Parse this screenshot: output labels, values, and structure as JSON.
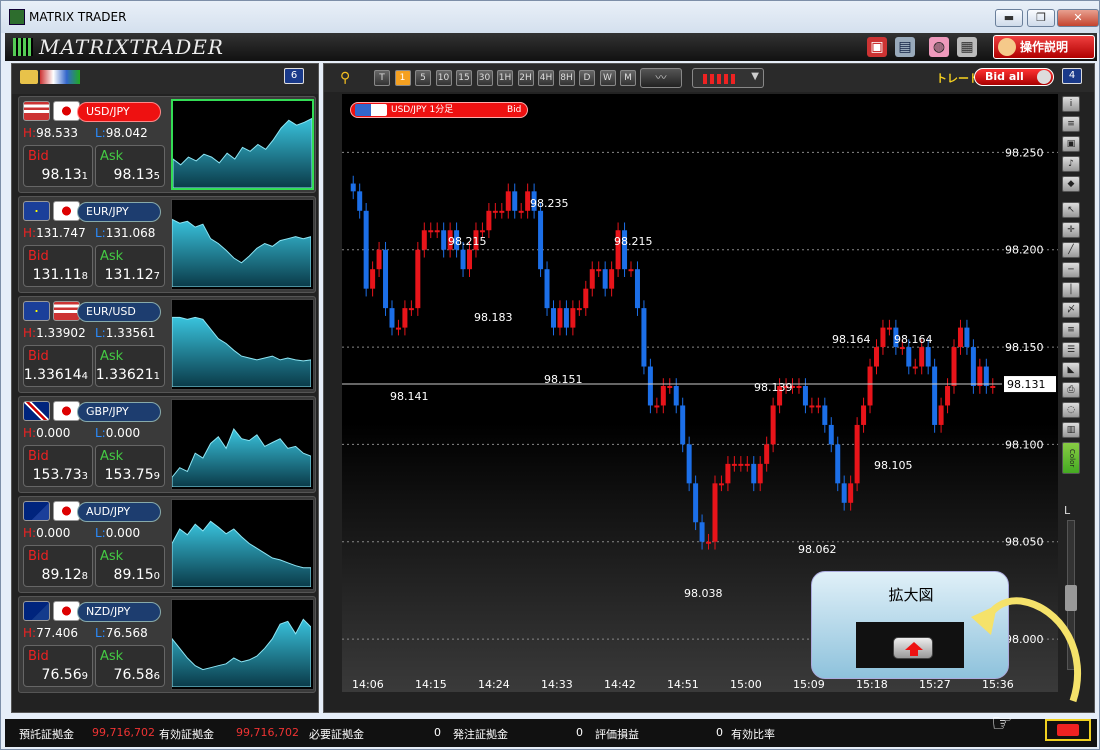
{
  "window": {
    "title": "MATRIX TRADER",
    "min_label": "▬",
    "max_label": "❐",
    "close_label": "✕"
  },
  "brand": {
    "logo_text": "MATRIXTRADER",
    "help_label": "操作説明"
  },
  "left_panel": {
    "count_badge": "6"
  },
  "pairs": [
    {
      "name": "USD/JPY",
      "flags": [
        "us",
        "jp"
      ],
      "active": true,
      "high_label": "H:",
      "high": "98.533",
      "low_label": "L:",
      "low": "98.042",
      "bid_label": "Bid",
      "bid_main": "98.13",
      "bid_pip": "1",
      "ask_label": "Ask",
      "ask_main": "98.13",
      "ask_pip": "5"
    },
    {
      "name": "EUR/JPY",
      "flags": [
        "eu",
        "jp"
      ],
      "active": false,
      "high_label": "H:",
      "high": "131.747",
      "low_label": "L:",
      "low": "131.068",
      "bid_label": "Bid",
      "bid_main": "131.11",
      "bid_pip": "8",
      "ask_label": "Ask",
      "ask_main": "131.12",
      "ask_pip": "7"
    },
    {
      "name": "EUR/USD",
      "flags": [
        "eu",
        "us"
      ],
      "active": false,
      "high_label": "H:",
      "high": "1.33902",
      "low_label": "L:",
      "low": "1.33561",
      "bid_label": "Bid",
      "bid_main": "1.33614",
      "bid_pip": "4",
      "ask_label": "Ask",
      "ask_main": "1.33621",
      "ask_pip": "1"
    },
    {
      "name": "GBP/JPY",
      "flags": [
        "gb",
        "jp"
      ],
      "active": false,
      "high_label": "H:",
      "high": "0.000",
      "low_label": "L:",
      "low": "0.000",
      "bid_label": "Bid",
      "bid_main": "153.73",
      "bid_pip": "3",
      "ask_label": "Ask",
      "ask_main": "153.75",
      "ask_pip": "9"
    },
    {
      "name": "AUD/JPY",
      "flags": [
        "au",
        "jp"
      ],
      "active": false,
      "high_label": "H:",
      "high": "0.000",
      "low_label": "L:",
      "low": "0.000",
      "bid_label": "Bid",
      "bid_main": "89.12",
      "bid_pip": "8",
      "ask_label": "Ask",
      "ask_main": "89.15",
      "ask_pip": "0"
    },
    {
      "name": "NZD/JPY",
      "flags": [
        "nz",
        "jp"
      ],
      "active": false,
      "high_label": "H:",
      "high": "77.406",
      "low_label": "L:",
      "low": "76.568",
      "bid_label": "Bid",
      "bid_main": "76.56",
      "bid_pip": "9",
      "ask_label": "Ask",
      "ask_main": "76.58",
      "ask_pip": "6"
    }
  ],
  "chart_toolbar": {
    "timeframes": [
      "T",
      "1",
      "5",
      "10",
      "15",
      "30",
      "1H",
      "2H",
      "4H",
      "8H",
      "D",
      "W",
      "M"
    ],
    "active_timeframe": "1",
    "trade_label": "トレード",
    "bid_all_label": "Bid all",
    "count_badge": "4"
  },
  "chart_tag": {
    "symbol_label": "USD/JPY 1分足",
    "side_label": "Bid"
  },
  "chart_data": {
    "type": "candlestick",
    "symbol": "USD/JPY",
    "timeframe": "1分足",
    "price_axis_ticks": [
      "98.250",
      "98.200",
      "98.150",
      "98.100",
      "98.050",
      "98.000"
    ],
    "ylim": [
      97.98,
      98.28
    ],
    "time_axis_ticks": [
      "14:06",
      "14:15",
      "14:24",
      "14:33",
      "14:42",
      "14:51",
      "15:00",
      "15:09",
      "15:18",
      "15:27",
      "15:36"
    ],
    "current_price": "98.131",
    "annotations": [
      "98.141",
      "98.215",
      "98.183",
      "98.235",
      "98.151",
      "98.215",
      "98.038",
      "98.139",
      "98.062",
      "98.164",
      "98.164",
      "98.105"
    ],
    "grid": true,
    "close_series": [
      98.23,
      98.22,
      98.18,
      98.19,
      98.2,
      98.17,
      98.16,
      98.16,
      98.17,
      98.17,
      98.2,
      98.21,
      98.21,
      98.21,
      98.2,
      98.21,
      98.2,
      98.19,
      98.2,
      98.21,
      98.21,
      98.22,
      98.22,
      98.22,
      98.23,
      98.22,
      98.22,
      98.23,
      98.22,
      98.19,
      98.17,
      98.16,
      98.17,
      98.16,
      98.17,
      98.17,
      98.18,
      98.19,
      98.19,
      98.18,
      98.19,
      98.21,
      98.19,
      98.19,
      98.17,
      98.14,
      98.12,
      98.12,
      98.13,
      98.13,
      98.12,
      98.1,
      98.08,
      98.06,
      98.05,
      98.05,
      98.08,
      98.08,
      98.09,
      98.09,
      98.09,
      98.09,
      98.08,
      98.09,
      98.1,
      98.12,
      98.13,
      98.13,
      98.13,
      98.13,
      98.12,
      98.12,
      98.12,
      98.11,
      98.1,
      98.08,
      98.07,
      98.08,
      98.11,
      98.12,
      98.14,
      98.15,
      98.16,
      98.16,
      98.15,
      98.15,
      98.14,
      98.14,
      98.15,
      98.14,
      98.11,
      98.12,
      98.13,
      98.15,
      98.16,
      98.15,
      98.13,
      98.14,
      98.13,
      98.13
    ]
  },
  "zoom_callout": {
    "title": "拡大図"
  },
  "status": {
    "items": [
      {
        "label": "預託証拠金",
        "value": "99,716,702"
      },
      {
        "label": "有効証拠金",
        "value": "99,716,702"
      },
      {
        "label": "必要証拠金",
        "value": "0"
      },
      {
        "label": "発注証拠金",
        "value": "0"
      },
      {
        "label": "評価損益",
        "value": "0"
      },
      {
        "label": "有効比率",
        "value": ""
      }
    ]
  },
  "right_tools": {
    "scroll_label": "L",
    "color_label": "Color"
  },
  "colors": {
    "up": "#e8141a",
    "down": "#1c6fe8",
    "spark_fill": "#39c3dd",
    "accent": "#f5d020"
  }
}
